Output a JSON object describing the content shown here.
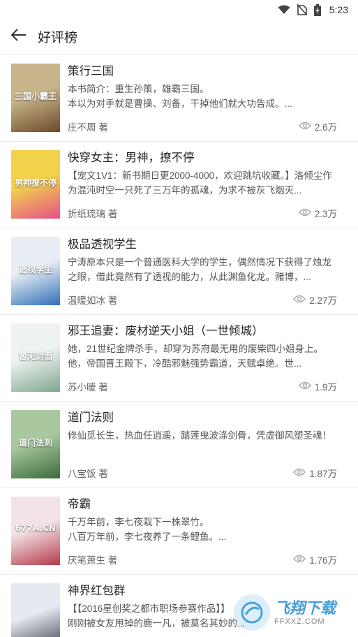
{
  "status_bar": {
    "time": "5:23",
    "icons": [
      "wifi-icon",
      "no-sim-icon",
      "battery-charging-icon"
    ]
  },
  "header": {
    "back_icon": "arrow-left-icon",
    "title": "好评榜"
  },
  "books": [
    {
      "title": "策行三国",
      "desc": "本书简介：重生孙策，雄霸三国。\n本以为对手就是曹操、刘备，干掉他们就大功告成。...",
      "author": "庄不周 著",
      "views": "2.6万",
      "cover_text": "三国小霸王",
      "cover_colors": [
        "#c8b48a",
        "#6b4a2a"
      ]
    },
    {
      "title": "快穿女主：男神，撩不停",
      "desc": "【宠文1V1：新书期日更2000-4000，欢迎跳坑收藏。】洛倾尘作为混沌时空一只死了三万年的孤魂，为求不被灰飞烟灭...",
      "author": "折纸琉璃 著",
      "views": "2.3万",
      "cover_text": "男神撩不停",
      "cover_colors": [
        "#f3d24b",
        "#e6508a"
      ]
    },
    {
      "title": "极品透视学生",
      "desc": "宁涛原本只是一个普通医科大学的学生，偶然情况下获得了烛龙之眼，借此竟然有了透视的能力，从此渊鱼化龙。赌博，...",
      "author": "温暖如冰 著",
      "views": "2.27万",
      "cover_text": "透视学生",
      "cover_colors": [
        "#e9eef5",
        "#2f6fb6"
      ]
    },
    {
      "title": "邪王追妻：废材逆天小姐（一世倾城）",
      "desc": "她，21世纪金牌杀手，却穿为苏府最无用的废柴四小姐身上。他，帝国晋王殿下，冷酷邪魅强势霸道，天赋卓绝。世...",
      "author": "苏小暖 著",
      "views": "1.9万",
      "cover_text": "暂无封面",
      "cover_colors": [
        "#eef3f0",
        "#7fa68e"
      ]
    },
    {
      "title": "道门法则",
      "desc": "修仙觅长生，热血任逍遥，踏莲曳波涤剑骨，凭虚御风塑圣魂！",
      "author": "八宝饭 著",
      "views": "1.87万",
      "cover_text": "道门法则",
      "cover_colors": [
        "#a9c8a0",
        "#3b6b3a"
      ]
    },
    {
      "title": "帝霸",
      "desc": "千万年前，李七夜栽下一株翠竹。\n八百万年前，李七夜养了一条鲤鱼。...",
      "author": "厌笔萧生 著",
      "views": "1.76万",
      "cover_text": "677A.CN",
      "cover_colors": [
        "#f3e3e6",
        "#b43a4a"
      ]
    },
    {
      "title": "神界红包群",
      "desc": "【【2016星创奖之都市职场参赛作品】】\n刚刚被女友甩掉的鹿一凡，被莫名其妙的...",
      "author": "",
      "views": "",
      "cover_text": "",
      "cover_colors": [
        "#e6eaf0",
        "#3a3a44"
      ]
    }
  ],
  "watermark": {
    "title": "飞翔下载",
    "sub": "FFXXZ.COM"
  }
}
